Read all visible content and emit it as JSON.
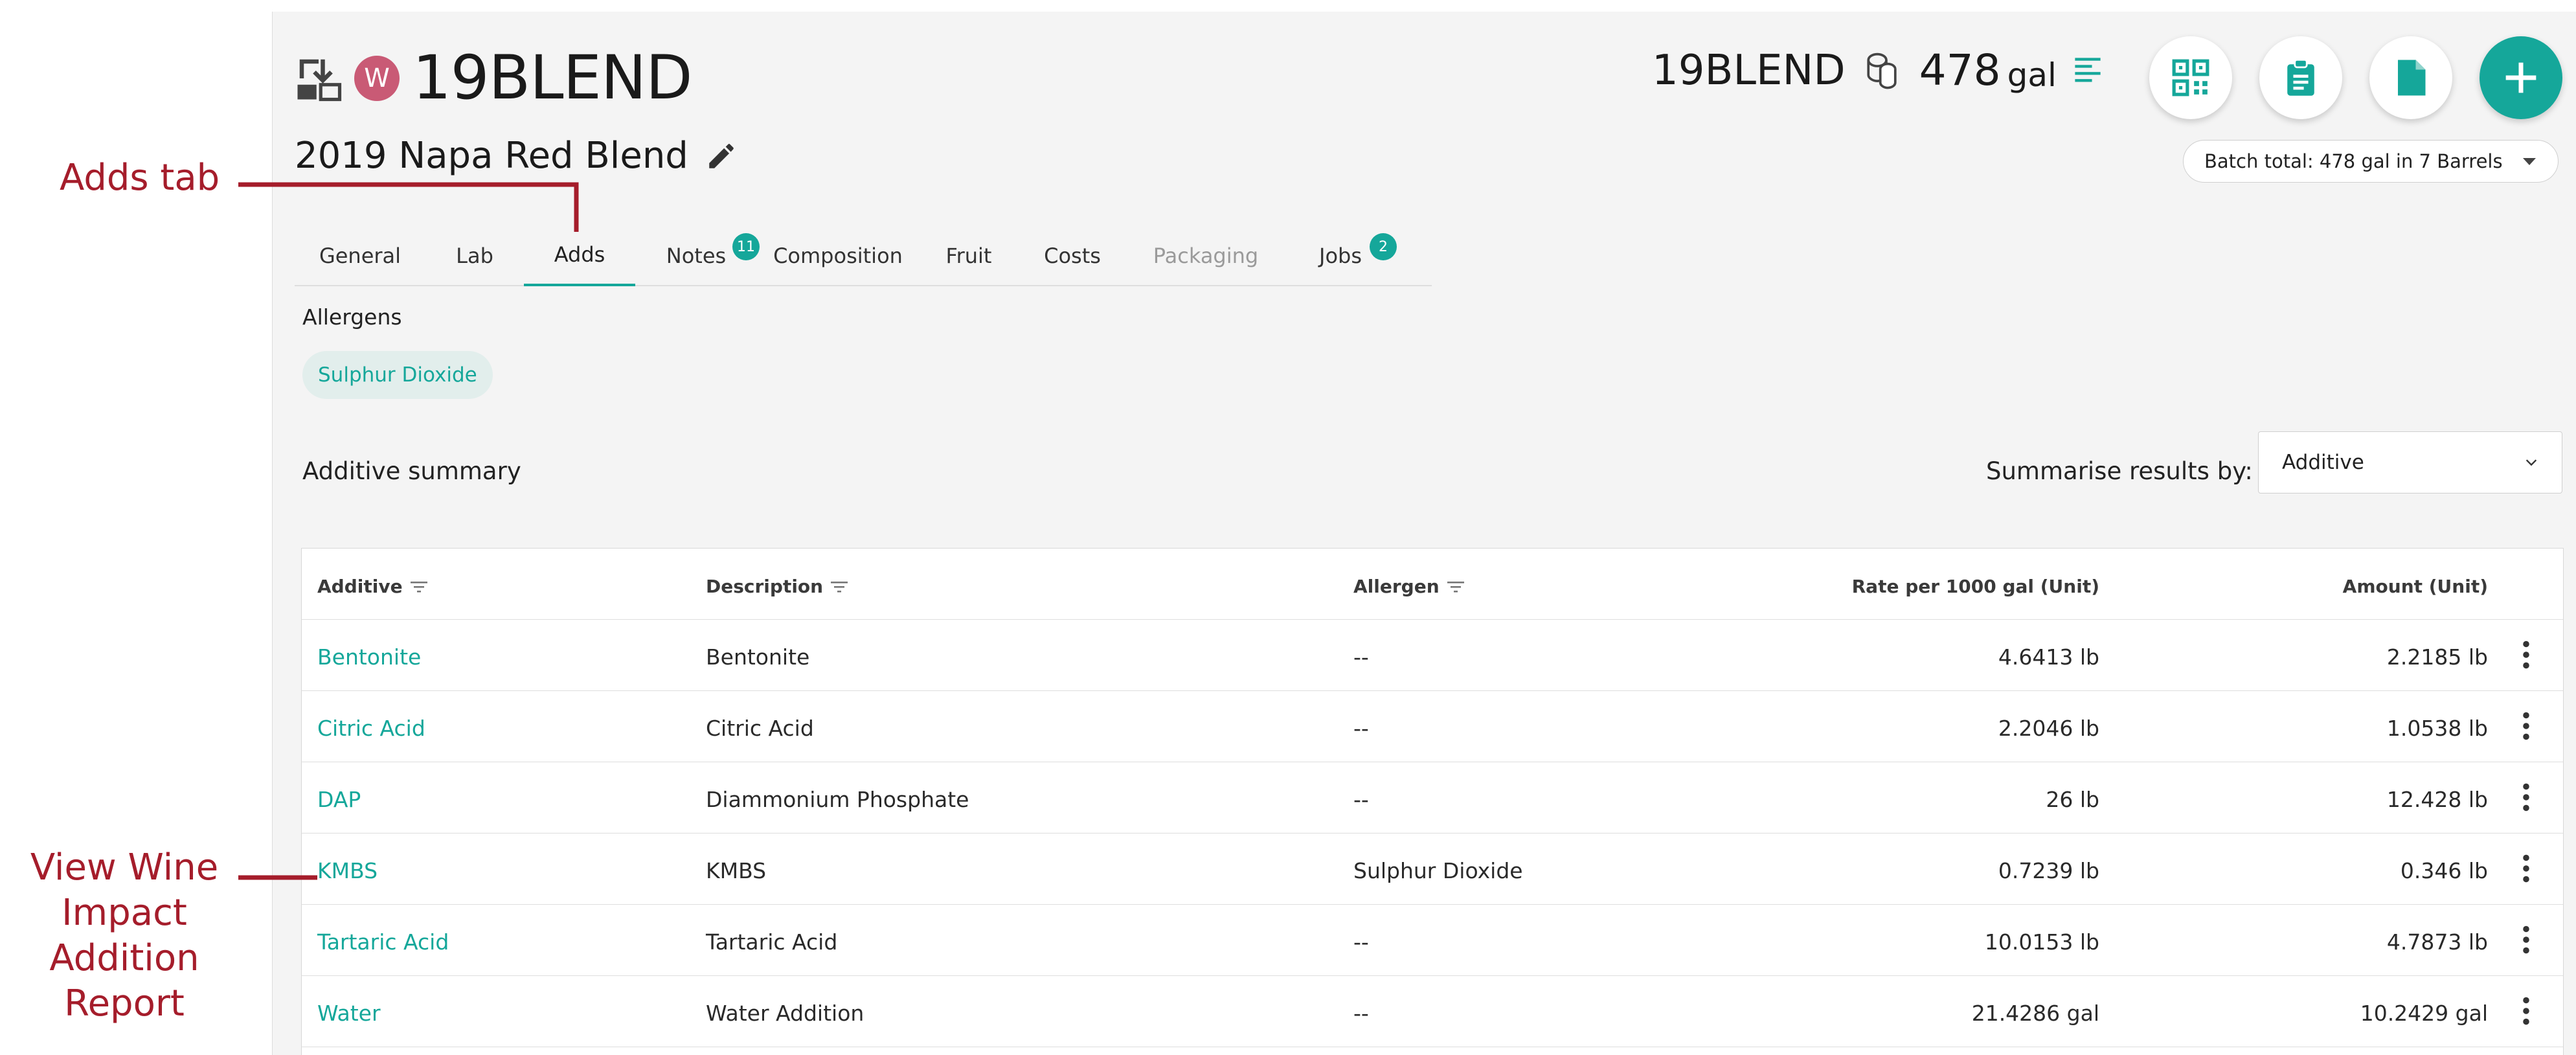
{
  "header": {
    "batch_code": "19BLEND",
    "avatar_letter": "W",
    "right_code": "19BLEND",
    "volume": "478",
    "volume_unit": "gal",
    "wine_name": "2019 Napa Red Blend",
    "batch_total": "Batch total: 478 gal in 7 Barrels"
  },
  "tabs": [
    {
      "label": "General"
    },
    {
      "label": "Lab"
    },
    {
      "label": "Adds"
    },
    {
      "label": "Notes",
      "badge": "11"
    },
    {
      "label": "Composition"
    },
    {
      "label": "Fruit"
    },
    {
      "label": "Costs"
    },
    {
      "label": "Packaging"
    },
    {
      "label": "Jobs",
      "badge": "2"
    }
  ],
  "allergens": {
    "heading": "Allergens",
    "items": [
      "Sulphur Dioxide"
    ]
  },
  "summary": {
    "title": "Additive summary",
    "summarise_label": "Summarise results by:",
    "summarise_value": "Additive"
  },
  "table": {
    "headers": [
      "Additive",
      "Description",
      "Allergen",
      "Rate per 1000 gal (Unit)",
      "Amount (Unit)"
    ],
    "rows": [
      {
        "additive": "Bentonite",
        "description": "Bentonite",
        "allergen": "--",
        "rate": "4.6413 lb",
        "amount": "2.2185 lb"
      },
      {
        "additive": "Citric Acid",
        "description": "Citric Acid",
        "allergen": "--",
        "rate": "2.2046 lb",
        "amount": "1.0538 lb"
      },
      {
        "additive": "DAP",
        "description": "Diammonium Phosphate",
        "allergen": "--",
        "rate": "26 lb",
        "amount": "12.428 lb"
      },
      {
        "additive": "KMBS",
        "description": "KMBS",
        "allergen": "Sulphur Dioxide",
        "rate": "0.7239 lb",
        "amount": "0.346 lb"
      },
      {
        "additive": "Tartaric Acid",
        "description": "Tartaric Acid",
        "allergen": "--",
        "rate": "10.0153 lb",
        "amount": "4.7873 lb"
      },
      {
        "additive": "Water",
        "description": "Water Addition",
        "allergen": "--",
        "rate": "21.4286 gal",
        "amount": "10.2429 gal"
      }
    ]
  },
  "annotations": {
    "adds_tab": "Adds tab",
    "view_report": "View Wine Impact Addition Report"
  },
  "colors": {
    "accent": "#15a79a",
    "annotation": "#a51d2b",
    "avatar": "#c95a75"
  }
}
